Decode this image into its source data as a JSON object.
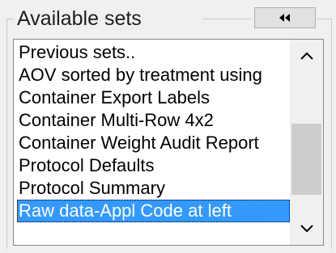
{
  "panel": {
    "title": "Available sets",
    "collapse_icon": "double-left-arrow-icon"
  },
  "list": {
    "items": [
      "Previous sets..",
      "AOV sorted by treatment using",
      "Container Export Labels",
      "Container Multi-Row 4x2",
      "Container Weight Audit Report",
      "Protocol Defaults",
      "Protocol Summary",
      "Raw data-Appl Code at left"
    ],
    "selected": "Raw data-Appl Code at left"
  },
  "scrollbar": {
    "up_icon": "chevron-up-icon",
    "down_icon": "chevron-down-icon"
  },
  "colors": {
    "selection": "#3399ff",
    "selected_text": "#ffffff"
  }
}
